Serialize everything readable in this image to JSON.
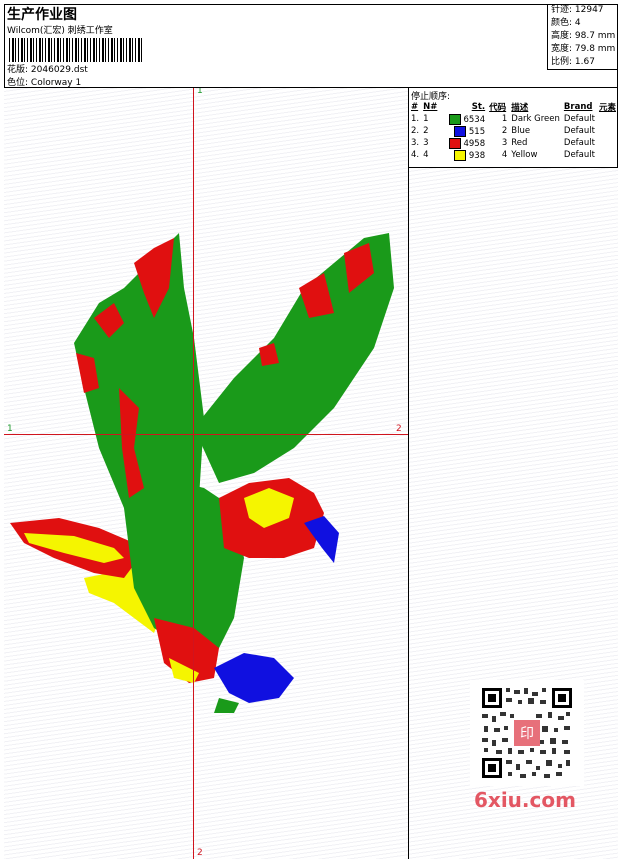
{
  "header": {
    "title": "生产作业图",
    "company": "Wilcom(汇宏) 刺绣工作室",
    "design_label": "花版:",
    "design_value": "2046029.dst",
    "colorway_label": "色位:",
    "colorway_value": "Colorway 1"
  },
  "stats": {
    "stitches": "针迹: 12947",
    "colors": "颜色: 4",
    "height": "高度: 98.7 mm",
    "width": "宽度: 79.8 mm",
    "ratio": "比例: 1.67"
  },
  "stop_sequence": {
    "label": "停止顺序:",
    "headers": [
      "#",
      "N#",
      "St.",
      "代码",
      "描述",
      "Brand",
      "元素"
    ],
    "rows": [
      {
        "idx": "1.",
        "n": "1",
        "color": "#1a9a1a",
        "stitches": "6534",
        "code": "1",
        "desc": "Dark Green",
        "brand": "Default"
      },
      {
        "idx": "2.",
        "n": "2",
        "color": "#1010e0",
        "stitches": "515",
        "code": "2",
        "desc": "Blue",
        "brand": "Default"
      },
      {
        "idx": "3.",
        "n": "3",
        "color": "#e01010",
        "stitches": "4958",
        "code": "3",
        "desc": "Red",
        "brand": "Default"
      },
      {
        "idx": "4.",
        "n": "4",
        "color": "#f5f500",
        "stitches": "938",
        "code": "4",
        "desc": "Yellow",
        "brand": "Default"
      }
    ]
  },
  "axes": {
    "v_top": "1",
    "v_bottom": "2",
    "h_left": "1",
    "h_right": "2"
  },
  "watermark": {
    "text": "6xiu.com",
    "qr_stamp": "印"
  },
  "colors": {
    "crosshair": "#d0141e",
    "green": "#1a9a1a",
    "red": "#e01010",
    "yellow": "#f5f500",
    "blue": "#1010e0"
  }
}
